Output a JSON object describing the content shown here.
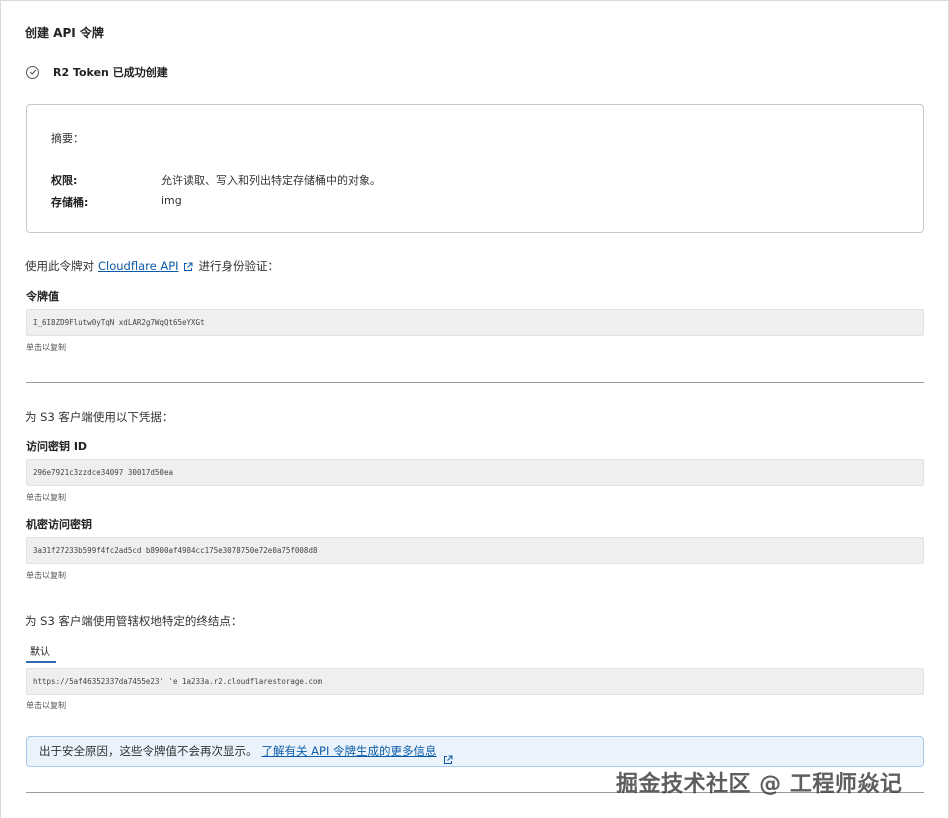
{
  "header": {
    "title": "创建 API 令牌"
  },
  "success": {
    "message": "R2 Token 已成功创建"
  },
  "summary": {
    "title": "摘要：",
    "permission_key": "权限:",
    "permission_value": "允许读取、写入和列出特定存储桶中的对象。",
    "bucket_key": "存储桶:",
    "bucket_value": "img"
  },
  "auth": {
    "prefix": "使用此令牌对",
    "link": "Cloudflare API",
    "suffix": "进行身份验证："
  },
  "token": {
    "label": "令牌值",
    "value": "I_6I8ZD9Flutw0yTqN   xdLAR2g7WqQt65eYXGt",
    "hint": "单击以复制"
  },
  "s3": {
    "intro": "为 S3 客户端使用以下凭据：",
    "access_key_label": "访问密钥 ID",
    "access_key_value": "296e7921c3zzdce34097   30017d50ea",
    "access_key_hint": "单击以复制",
    "secret_label": "机密访问密钥",
    "secret_value": "3a31f27233b599f4fc2ad5cd   b8900af4984cc175e3078750e72e0a75f008d8",
    "secret_hint": "单击以复制"
  },
  "endpoint": {
    "intro": "为 S3 客户端使用管辖权地特定的终结点：",
    "tab_default": "默认",
    "value": "https://5af46352337da7455e23'   'e   1a233a.r2.cloudflarestorage.com",
    "hint": "单击以复制"
  },
  "notice": {
    "text": "出于安全原因，这些令牌值不会再次显示。",
    "link": "了解有关 API 令牌生成的更多信息"
  },
  "watermark": "掘金技术社区 @ 工程师焱记",
  "icons": {
    "success": "check-circle-icon",
    "external": "external-link-icon"
  },
  "colors": {
    "link": "#0b5ba8",
    "field_bg": "#efefef",
    "notice_bg": "#eaf3fc",
    "notice_border": "#a9c9ea"
  }
}
